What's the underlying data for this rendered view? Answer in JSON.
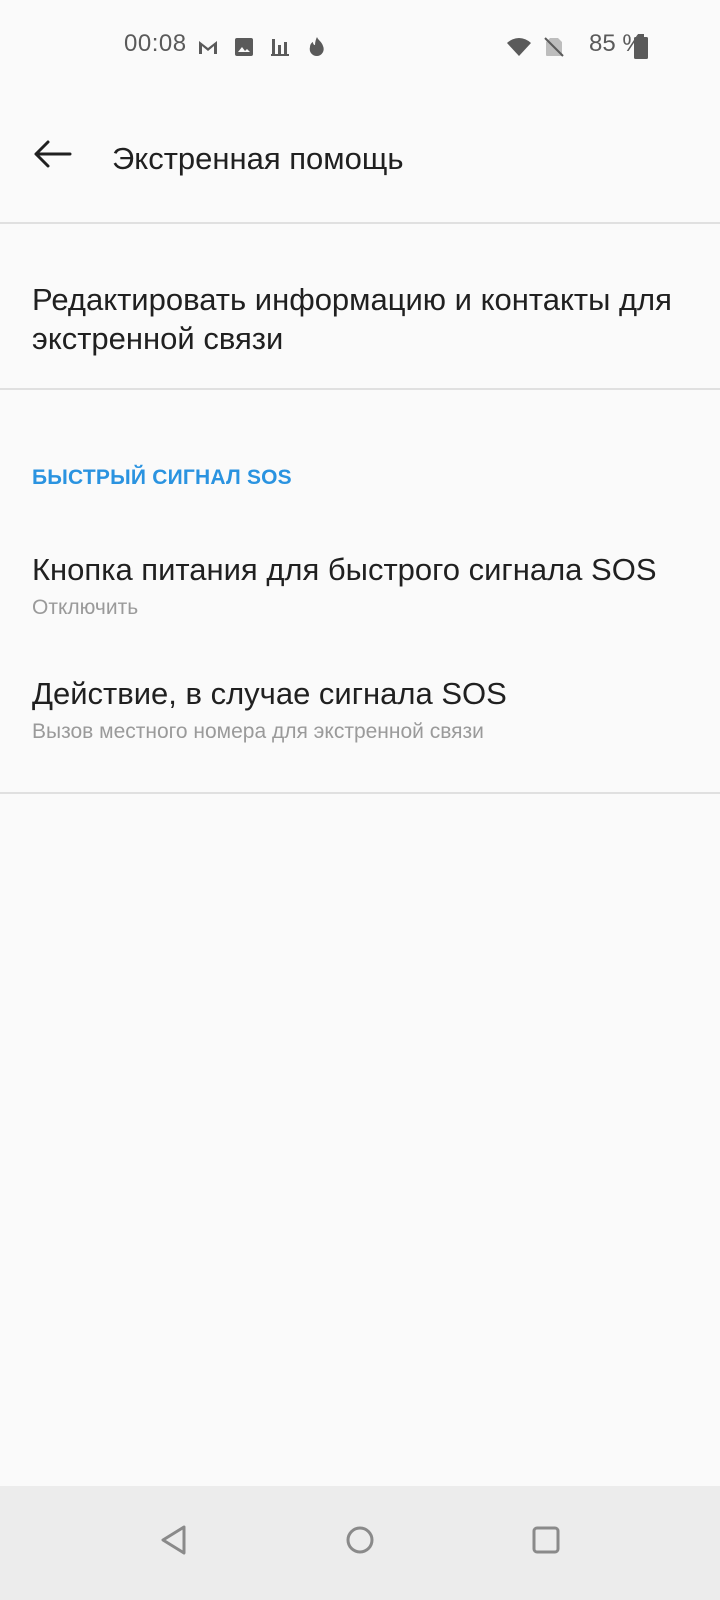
{
  "status_bar": {
    "time": "00:08",
    "battery_percent": "85 %",
    "icons": [
      "gmail-icon",
      "image-icon",
      "chart-icon",
      "fire-icon",
      "wifi-icon",
      "no-sim-icon",
      "battery-icon"
    ]
  },
  "app_bar": {
    "title": "Экстренная помощь",
    "back_icon": "arrow-back-icon"
  },
  "edit_item": {
    "title": "Редактировать информацию и контакты для экстренной связи"
  },
  "section": {
    "header": "БЫСТРЫЙ СИГНАЛ SOS",
    "items": [
      {
        "title": "Кнопка питания для быстрого сигнала SOS",
        "subtitle": "Отключить"
      },
      {
        "title": "Действие, в случае сигнала SOS",
        "subtitle": "Вызов местного номера для экстренной связи"
      }
    ]
  },
  "nav_bar": {
    "icons": [
      "nav-back-icon",
      "nav-home-icon",
      "nav-recents-icon"
    ]
  },
  "colors": {
    "accent": "#2a93e0",
    "background": "#fafafa",
    "divider": "#e0e0e0",
    "secondary_text": "#9a9a9a"
  }
}
